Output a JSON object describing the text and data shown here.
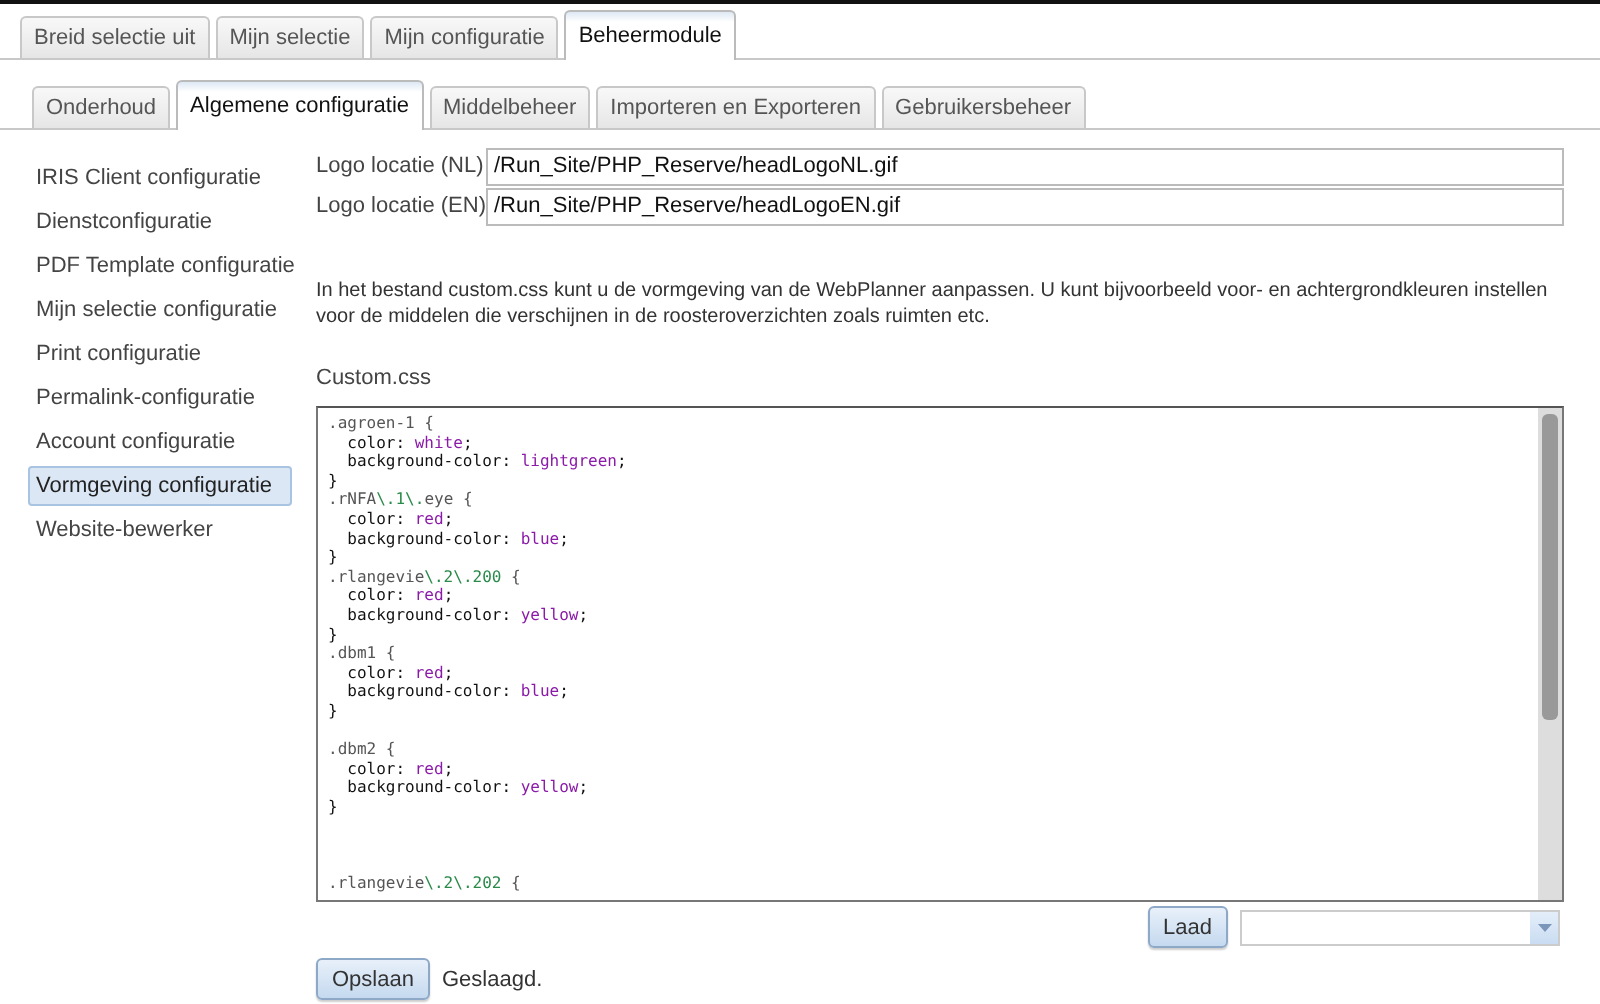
{
  "top_tabs": [
    {
      "label": "Breid selectie uit",
      "selected": false
    },
    {
      "label": "Mijn selectie",
      "selected": false
    },
    {
      "label": "Mijn configuratie",
      "selected": false
    },
    {
      "label": "Beheermodule",
      "selected": true
    }
  ],
  "sub_tabs": [
    {
      "label": "Onderhoud",
      "selected": false
    },
    {
      "label": "Algemene configuratie",
      "selected": true
    },
    {
      "label": "Middelbeheer",
      "selected": false
    },
    {
      "label": "Importeren en Exporteren",
      "selected": false
    },
    {
      "label": "Gebruikersbeheer",
      "selected": false
    }
  ],
  "sidebar": {
    "items": [
      {
        "label": "IRIS Client configuratie",
        "selected": false
      },
      {
        "label": "Dienstconfiguratie",
        "selected": false
      },
      {
        "label": "PDF Template configuratie",
        "selected": false
      },
      {
        "label": "Mijn selectie configuratie",
        "selected": false
      },
      {
        "label": "Print configuratie",
        "selected": false
      },
      {
        "label": "Permalink-configuratie",
        "selected": false
      },
      {
        "label": "Account configuratie",
        "selected": false
      },
      {
        "label": "Vormgeving configuratie",
        "selected": true
      },
      {
        "label": "Website-bewerker",
        "selected": false
      }
    ]
  },
  "fields": [
    {
      "label": "Logo locatie (NL)",
      "value": "/Run_Site/PHP_Reserve/headLogoNL.gif"
    },
    {
      "label": "Logo locatie (EN)",
      "value": "/Run_Site/PHP_Reserve/headLogoEN.gif"
    }
  ],
  "description": "In het bestand custom.css kunt u de vormgeving van de WebPlanner aanpassen. U kunt bijvoorbeeld voor- en achtergrondkleuren instellen voor de middelen die verschijnen in de roosteroverzichten zoals ruimten etc.",
  "editor": {
    "label": "Custom.css",
    "lines": [
      [
        {
          "kind": "selector",
          "text": ".agroen-1 {"
        }
      ],
      [
        {
          "kind": "property",
          "text": "  color: "
        },
        {
          "kind": "value",
          "text": "white"
        },
        {
          "kind": "punct",
          "text": ";"
        }
      ],
      [
        {
          "kind": "property",
          "text": "  background-color: "
        },
        {
          "kind": "value",
          "text": "lightgreen"
        },
        {
          "kind": "punct",
          "text": ";"
        }
      ],
      [
        {
          "kind": "punct",
          "text": "}"
        }
      ],
      [
        {
          "kind": "selector",
          "text": ".rNFA"
        },
        {
          "kind": "escape",
          "text": "\\.1\\."
        },
        {
          "kind": "selector",
          "text": "eye {"
        }
      ],
      [
        {
          "kind": "property",
          "text": "  color: "
        },
        {
          "kind": "value",
          "text": "red"
        },
        {
          "kind": "punct",
          "text": ";"
        }
      ],
      [
        {
          "kind": "property",
          "text": "  background-color: "
        },
        {
          "kind": "value",
          "text": "blue"
        },
        {
          "kind": "punct",
          "text": ";"
        }
      ],
      [
        {
          "kind": "punct",
          "text": "}"
        }
      ],
      [
        {
          "kind": "selector",
          "text": ".rlangevie"
        },
        {
          "kind": "escape",
          "text": "\\.2\\.200"
        },
        {
          "kind": "selector",
          "text": " {"
        }
      ],
      [
        {
          "kind": "property",
          "text": "  color: "
        },
        {
          "kind": "value",
          "text": "red"
        },
        {
          "kind": "punct",
          "text": ";"
        }
      ],
      [
        {
          "kind": "property",
          "text": "  background-color: "
        },
        {
          "kind": "value",
          "text": "yellow"
        },
        {
          "kind": "punct",
          "text": ";"
        }
      ],
      [
        {
          "kind": "punct",
          "text": "}"
        }
      ],
      [
        {
          "kind": "selector",
          "text": ".dbm1 {"
        }
      ],
      [
        {
          "kind": "property",
          "text": "  color: "
        },
        {
          "kind": "value",
          "text": "red"
        },
        {
          "kind": "punct",
          "text": ";"
        }
      ],
      [
        {
          "kind": "property",
          "text": "  background-color: "
        },
        {
          "kind": "value",
          "text": "blue"
        },
        {
          "kind": "punct",
          "text": ";"
        }
      ],
      [
        {
          "kind": "punct",
          "text": "}"
        }
      ],
      {
        "kind": "blank"
      },
      [
        {
          "kind": "selector",
          "text": ".dbm2 {"
        }
      ],
      [
        {
          "kind": "property",
          "text": "  color: "
        },
        {
          "kind": "value",
          "text": "red"
        },
        {
          "kind": "punct",
          "text": ";"
        }
      ],
      [
        {
          "kind": "property",
          "text": "  background-color: "
        },
        {
          "kind": "value",
          "text": "yellow"
        },
        {
          "kind": "punct",
          "text": ";"
        }
      ],
      [
        {
          "kind": "punct",
          "text": "}"
        }
      ],
      {
        "kind": "blank"
      },
      {
        "kind": "blank"
      },
      {
        "kind": "blank"
      },
      [
        {
          "kind": "selector",
          "text": ".rlangevie"
        },
        {
          "kind": "escape",
          "text": "\\.2\\.202"
        },
        {
          "kind": "selector",
          "text": " {"
        }
      ]
    ]
  },
  "load_button": "Laad",
  "save_button": "Opslaan",
  "status": "Geslaagd."
}
